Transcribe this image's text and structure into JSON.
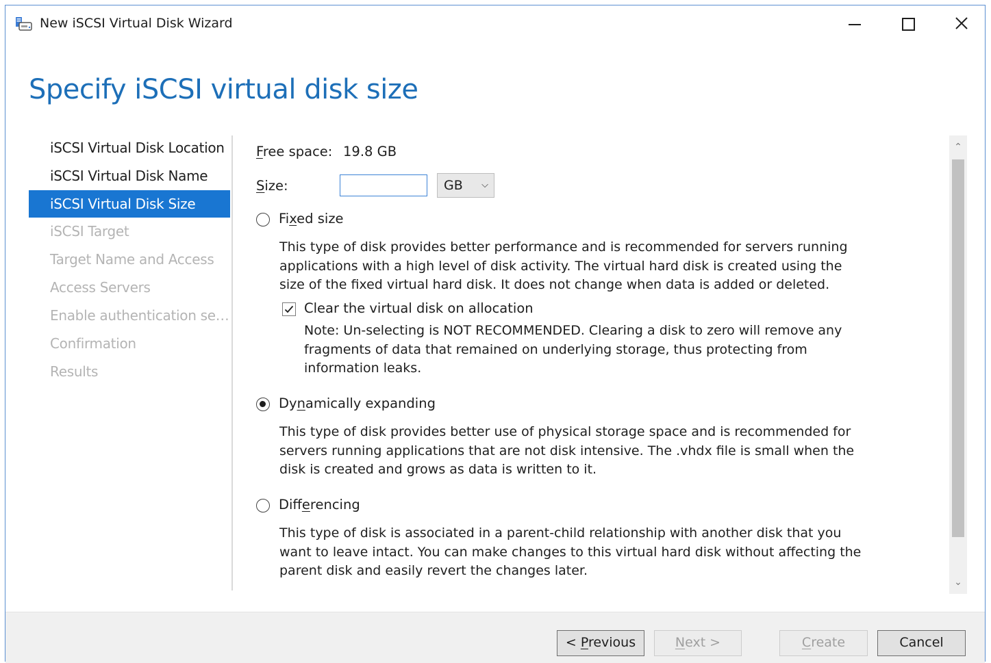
{
  "window": {
    "title": "New iSCSI Virtual Disk Wizard"
  },
  "page": {
    "title": "Specify iSCSI virtual disk size"
  },
  "nav": {
    "items": [
      {
        "label": "iSCSI Virtual Disk Location",
        "state": "normal"
      },
      {
        "label": "iSCSI Virtual Disk Name",
        "state": "normal"
      },
      {
        "label": "iSCSI Virtual Disk Size",
        "state": "active"
      },
      {
        "label": "iSCSI Target",
        "state": "disabled"
      },
      {
        "label": "Target Name and Access",
        "state": "disabled"
      },
      {
        "label": "Access Servers",
        "state": "disabled"
      },
      {
        "label": "Enable authentication ser...",
        "state": "disabled"
      },
      {
        "label": "Confirmation",
        "state": "disabled"
      },
      {
        "label": "Results",
        "state": "disabled"
      }
    ]
  },
  "content": {
    "free_space": {
      "label_accel": "F",
      "label_rest": "ree space:",
      "value": "19.8 GB"
    },
    "size": {
      "label_accel": "S",
      "label_rest": "ize:",
      "value": "",
      "unit": "GB"
    },
    "fixed": {
      "label_pre": "Fi",
      "label_accel": "x",
      "label_post": "ed size",
      "selected": false,
      "description": "This type of disk provides better performance and is recommended for servers running applications with a high level of disk activity. The virtual hard disk is created using the size of the fixed virtual hard disk. It does not change when data is added or deleted.",
      "clear_label": "Clear the virtual disk on allocation",
      "clear_checked": true,
      "note": "Note: Un-selecting is NOT RECOMMENDED. Clearing a disk to zero will remove any fragments of data that remained on underlying storage, thus protecting from information leaks."
    },
    "dynamic": {
      "label_pre": "Dy",
      "label_accel": "n",
      "label_post": "amically expanding",
      "selected": true,
      "description": "This type of disk provides better use of physical storage space and is recommended for servers running applications that are not disk intensive. The .vhdx file is small when the disk is created and grows as data is written to it."
    },
    "differencing": {
      "label_pre": "Diff",
      "label_accel": "e",
      "label_post": "rencing",
      "selected": false,
      "description": "This type of disk is associated in a parent-child relationship with another disk that you want to leave intact. You can make changes to this virtual hard disk without affecting the parent disk and easily revert the changes later."
    }
  },
  "footer": {
    "previous": {
      "pre": "< ",
      "accel": "P",
      "post": "revious"
    },
    "next": {
      "accel": "N",
      "post": "ext >"
    },
    "create": {
      "accel": "C",
      "post": "reate"
    },
    "cancel": "Cancel"
  },
  "colors": {
    "accent": "#1976d2",
    "title_blue": "#1d6fb8",
    "disabled_text": "#b4b4b4"
  }
}
